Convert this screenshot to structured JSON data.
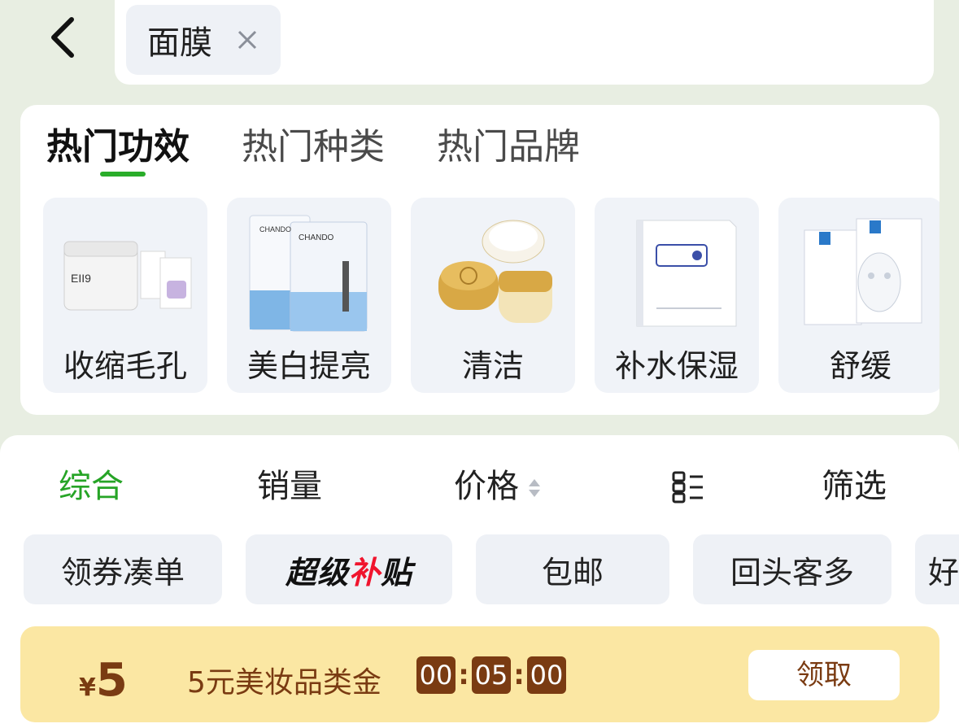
{
  "header": {
    "search_chip": "面膜",
    "back_icon": "chevron-left-icon",
    "clear_icon": "close-icon"
  },
  "category_tabs": [
    {
      "label": "热门功效",
      "active": true
    },
    {
      "label": "热门种类",
      "active": false
    },
    {
      "label": "热门品牌",
      "active": false
    }
  ],
  "category_items": [
    {
      "label": "收缩毛孔"
    },
    {
      "label": "美白提亮"
    },
    {
      "label": "清洁"
    },
    {
      "label": "补水保湿"
    },
    {
      "label": "舒缓"
    }
  ],
  "sort_bar": {
    "comprehensive": "综合",
    "sales": "销量",
    "price": "价格",
    "layout_icon": "list-layout-icon",
    "filter": "筛选"
  },
  "filter_chips": {
    "coupon": "领券凑单",
    "subsidy_prefix": "超级",
    "subsidy_accent": "补",
    "subsidy_suffix": "贴",
    "free_shipping": "包邮",
    "repeat_customers": "回头客多",
    "partial": "好"
  },
  "coupon_bar": {
    "currency": "¥",
    "amount": "5",
    "description": "5元美妆品类金",
    "timer_h": "00",
    "timer_m": "05",
    "timer_s": "00",
    "claim_label": "领取"
  },
  "colors": {
    "accent_green": "#26a426",
    "coupon_bg": "#fbe7a3",
    "coupon_text": "#7a3b12",
    "brand_red": "#f0142d"
  }
}
